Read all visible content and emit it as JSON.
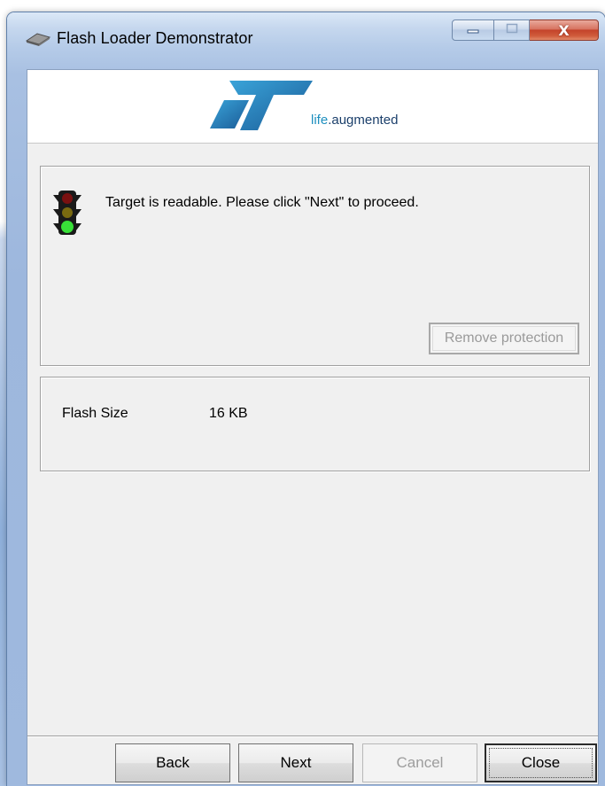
{
  "window": {
    "title": "Flash Loader Demonstrator",
    "close_glyph": "X"
  },
  "banner": {
    "logo_text": "ST",
    "tagline_life": "life",
    "tagline_rest": ".augmented",
    "colors": {
      "logo_primary": "#1a5a96",
      "logo_secondary": "#3aa4d9"
    }
  },
  "status": {
    "icon": "traffic-light-green-icon",
    "message": "Target is readable. Please click \"Next\" to proceed.",
    "remove_protection_label": "Remove protection"
  },
  "info": {
    "flash_size_label": "Flash Size",
    "flash_size_value": "16 KB"
  },
  "footer": {
    "back_label": "Back",
    "next_label": "Next",
    "cancel_label": "Cancel",
    "close_label": "Close"
  }
}
